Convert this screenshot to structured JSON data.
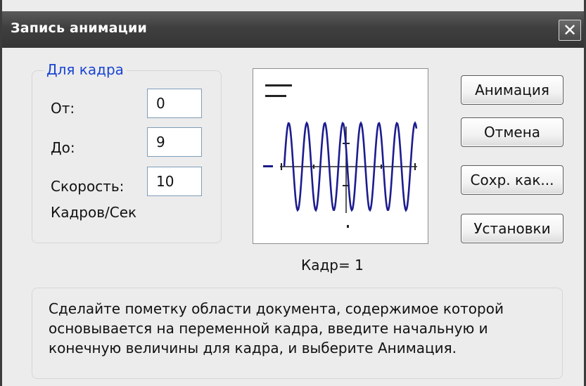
{
  "window": {
    "title": "Запись анимации",
    "close_glyph": "✕"
  },
  "frame_group": {
    "title": "Для кадра",
    "from_label": "От:",
    "from_value": "0",
    "to_label": "До:",
    "to_value": "9",
    "speed_label": "Скорость:",
    "speed_value": "10",
    "speed_unit": "Кадров/Сек"
  },
  "preview": {
    "frame_label": "Кадр=  1"
  },
  "buttons": {
    "animate": "Анимация",
    "cancel": "Отмена",
    "save_as": "Сохр. как...",
    "settings": "Установки"
  },
  "info": {
    "lines": [
      "Сделайте пометку области документа, содержимое которой",
      "основывается на переменной кадра, введите начальную и",
      "конечную величины для кадра, и выберите Анимация."
    ]
  }
}
